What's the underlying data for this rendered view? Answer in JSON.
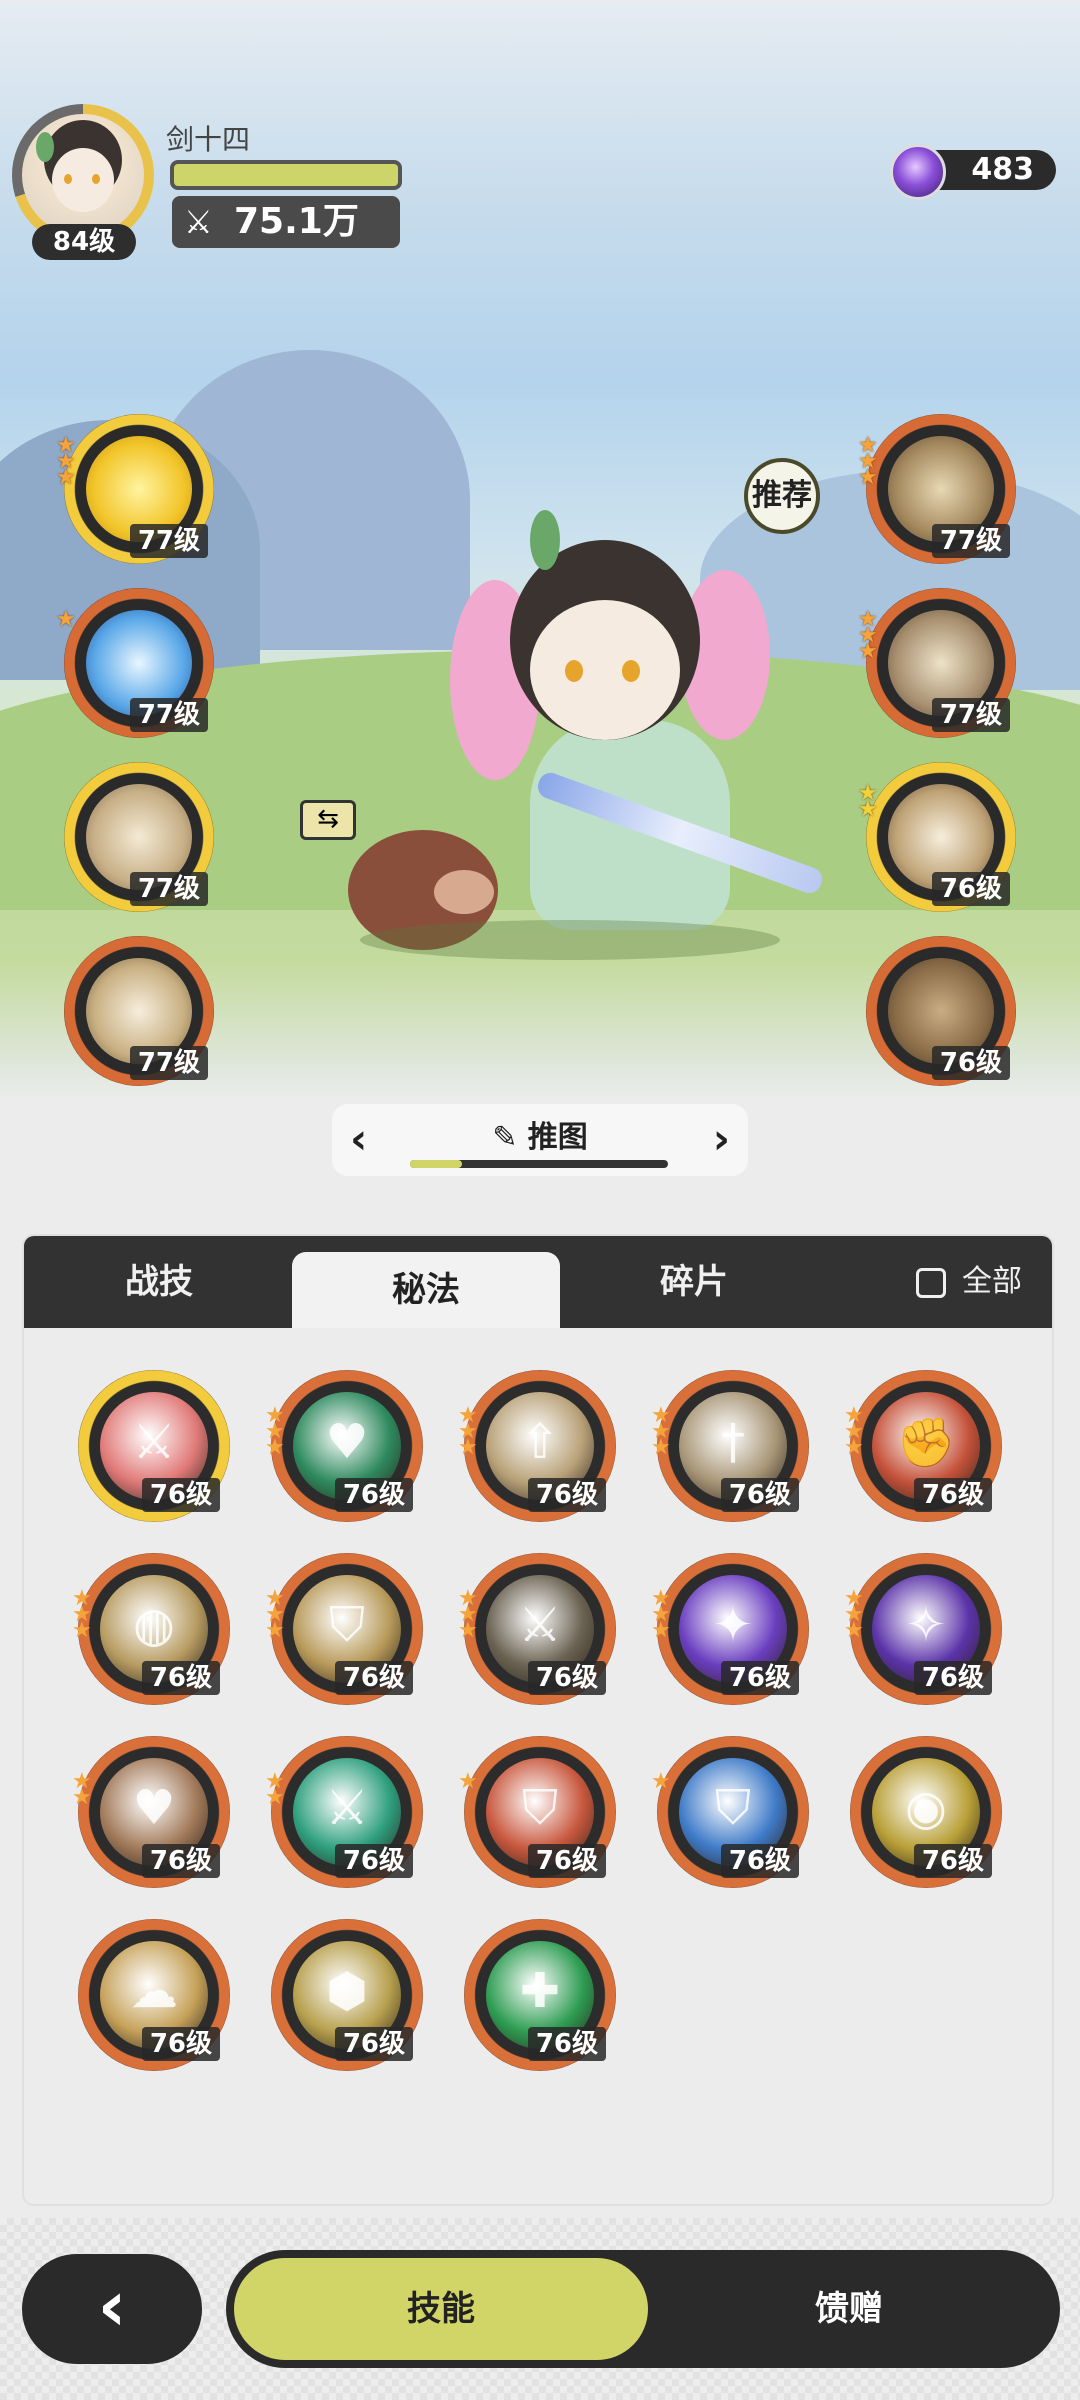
{
  "player": {
    "name": "剑十四",
    "level": "84级",
    "power": "75.1万",
    "hp_fraction": 1.0
  },
  "currency": {
    "amount": "483",
    "icon": "purple-gem-icon"
  },
  "recommend_label": "推荐",
  "left_skills": [
    {
      "level": "77级",
      "icon": "golden-crystal-icon",
      "stars": 3
    },
    {
      "level": "77级",
      "icon": "blue-clock-shield-icon",
      "stars": 1
    },
    {
      "level": "77级",
      "icon": "horn-icon",
      "stars": 0
    },
    {
      "level": "77级",
      "icon": "swirl-icon",
      "stars": 0
    }
  ],
  "right_skills": [
    {
      "level": "77级",
      "icon": "fist-icon",
      "stars": 3
    },
    {
      "level": "77级",
      "icon": "shield-slash-icon",
      "stars": 3
    },
    {
      "level": "76级",
      "icon": "blade-icon",
      "stars": 2
    },
    {
      "level": "76级",
      "icon": "cloud-icon",
      "stars": 0
    }
  ],
  "stage": {
    "title": "推图",
    "progress": 0.2,
    "edit_icon": "pencil-icon"
  },
  "tabs": [
    {
      "label": "战技",
      "active": false
    },
    {
      "label": "秘法",
      "active": true
    },
    {
      "label": "碎片",
      "active": false
    }
  ],
  "all_toggle": {
    "label": "全部",
    "checked": false
  },
  "grid": [
    {
      "level": "76级",
      "icon": "red-sword-icon",
      "color": "#e07a78",
      "stars": 0,
      "gold": true
    },
    {
      "level": "76级",
      "icon": "green-heart-icon",
      "color": "#2e8a5e",
      "stars": 3
    },
    {
      "level": "76级",
      "icon": "sword-up-icon",
      "color": "#b8a178",
      "stars": 3
    },
    {
      "level": "76级",
      "icon": "sword-down-icon",
      "color": "#a89677",
      "stars": 3
    },
    {
      "level": "76级",
      "icon": "red-fist-icon",
      "color": "#c5523a",
      "stars": 3
    },
    {
      "level": "76级",
      "icon": "armor-icon",
      "color": "#b79c62",
      "stars": 3
    },
    {
      "level": "76级",
      "icon": "shield-armor-icon",
      "color": "#b89a5a",
      "stars": 3
    },
    {
      "level": "76级",
      "icon": "sword-slash-icon",
      "color": "#6a6252",
      "stars": 3
    },
    {
      "level": "76级",
      "icon": "purple-beast-icon",
      "color": "#6a3ec0",
      "stars": 3
    },
    {
      "level": "76级",
      "icon": "purple-sword-icon",
      "color": "#5b33a8",
      "stars": 3
    },
    {
      "level": "76级",
      "icon": "heart-shield-icon",
      "color": "#a27a5a",
      "stars": 2
    },
    {
      "level": "76级",
      "icon": "green-blade-icon",
      "color": "#2fa07e",
      "stars": 2
    },
    {
      "level": "76级",
      "icon": "red-shield-icon",
      "color": "#c8583e",
      "stars": 1
    },
    {
      "level": "76级",
      "icon": "blue-shield-icon",
      "color": "#3f7bc8",
      "stars": 1
    },
    {
      "level": "76级",
      "icon": "eye-icon",
      "color": "#b9a038",
      "stars": 0
    },
    {
      "level": "76级",
      "icon": "golden-cloud-icon",
      "color": "#c6a25a",
      "stars": 0
    },
    {
      "level": "76级",
      "icon": "hexagon-icon",
      "color": "#b7a04e",
      "stars": 0
    },
    {
      "level": "76级",
      "icon": "green-cross-icon",
      "color": "#2e9d53",
      "stars": 0
    }
  ],
  "bottom": {
    "back_icon": "chevron-left-icon",
    "tab_skills": "技能",
    "tab_gift": "馈赠"
  }
}
